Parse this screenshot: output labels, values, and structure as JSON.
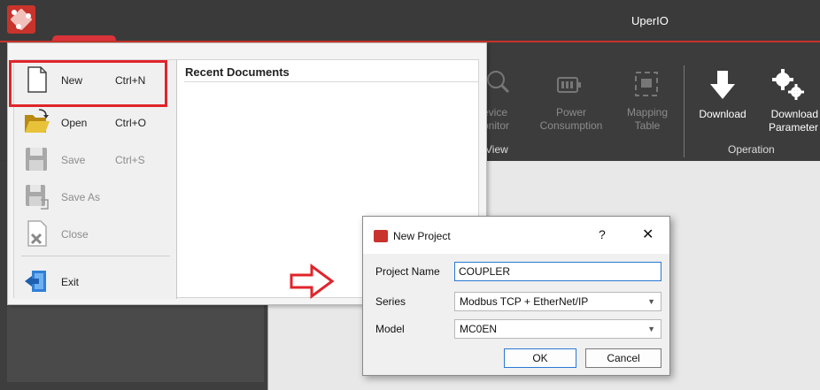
{
  "app": {
    "title": "UperIO",
    "logo_icon": "app-cube-logo-icon",
    "accent_color": "#c8332b"
  },
  "ribbon": {
    "view_buttons": [
      {
        "label": "evice\nonitor",
        "icon": "device-monitor-icon"
      },
      {
        "label": "Power\nConsumption",
        "icon": "power-consumption-icon"
      },
      {
        "label": "Mapping\nTable",
        "icon": "mapping-table-icon"
      }
    ],
    "view_group_label": "View",
    "operation_buttons": [
      {
        "label": "Download",
        "icon": "download-arrow-icon"
      },
      {
        "label": "Download\nParameter",
        "icon": "gears-icon"
      }
    ],
    "operation_group_label": "Operation"
  },
  "file_menu": {
    "items": [
      {
        "label": "New",
        "shortcut": "Ctrl+N",
        "icon": "new-document-icon",
        "enabled": true
      },
      {
        "label": "Open",
        "shortcut": "Ctrl+O",
        "icon": "open-folder-icon",
        "enabled": true
      },
      {
        "label": "Save",
        "shortcut": "Ctrl+S",
        "icon": "save-disk-icon",
        "enabled": false
      },
      {
        "label": "Save As",
        "shortcut": "",
        "icon": "save-as-icon",
        "enabled": false
      },
      {
        "label": "Close",
        "shortcut": "",
        "icon": "close-document-icon",
        "enabled": false
      },
      {
        "label": "Exit",
        "shortcut": "",
        "icon": "exit-door-icon",
        "enabled": true
      }
    ],
    "recent_title": "Recent Documents"
  },
  "dialog": {
    "title": "New Project",
    "help": "?",
    "close": "✕",
    "project_name_label": "Project Name",
    "project_name_value": "COUPLER",
    "series_label": "Series",
    "series_value": "Modbus TCP + EtherNet/IP",
    "model_label": "Model",
    "model_value": "MC0EN",
    "ok_label": "OK",
    "cancel_label": "Cancel"
  }
}
